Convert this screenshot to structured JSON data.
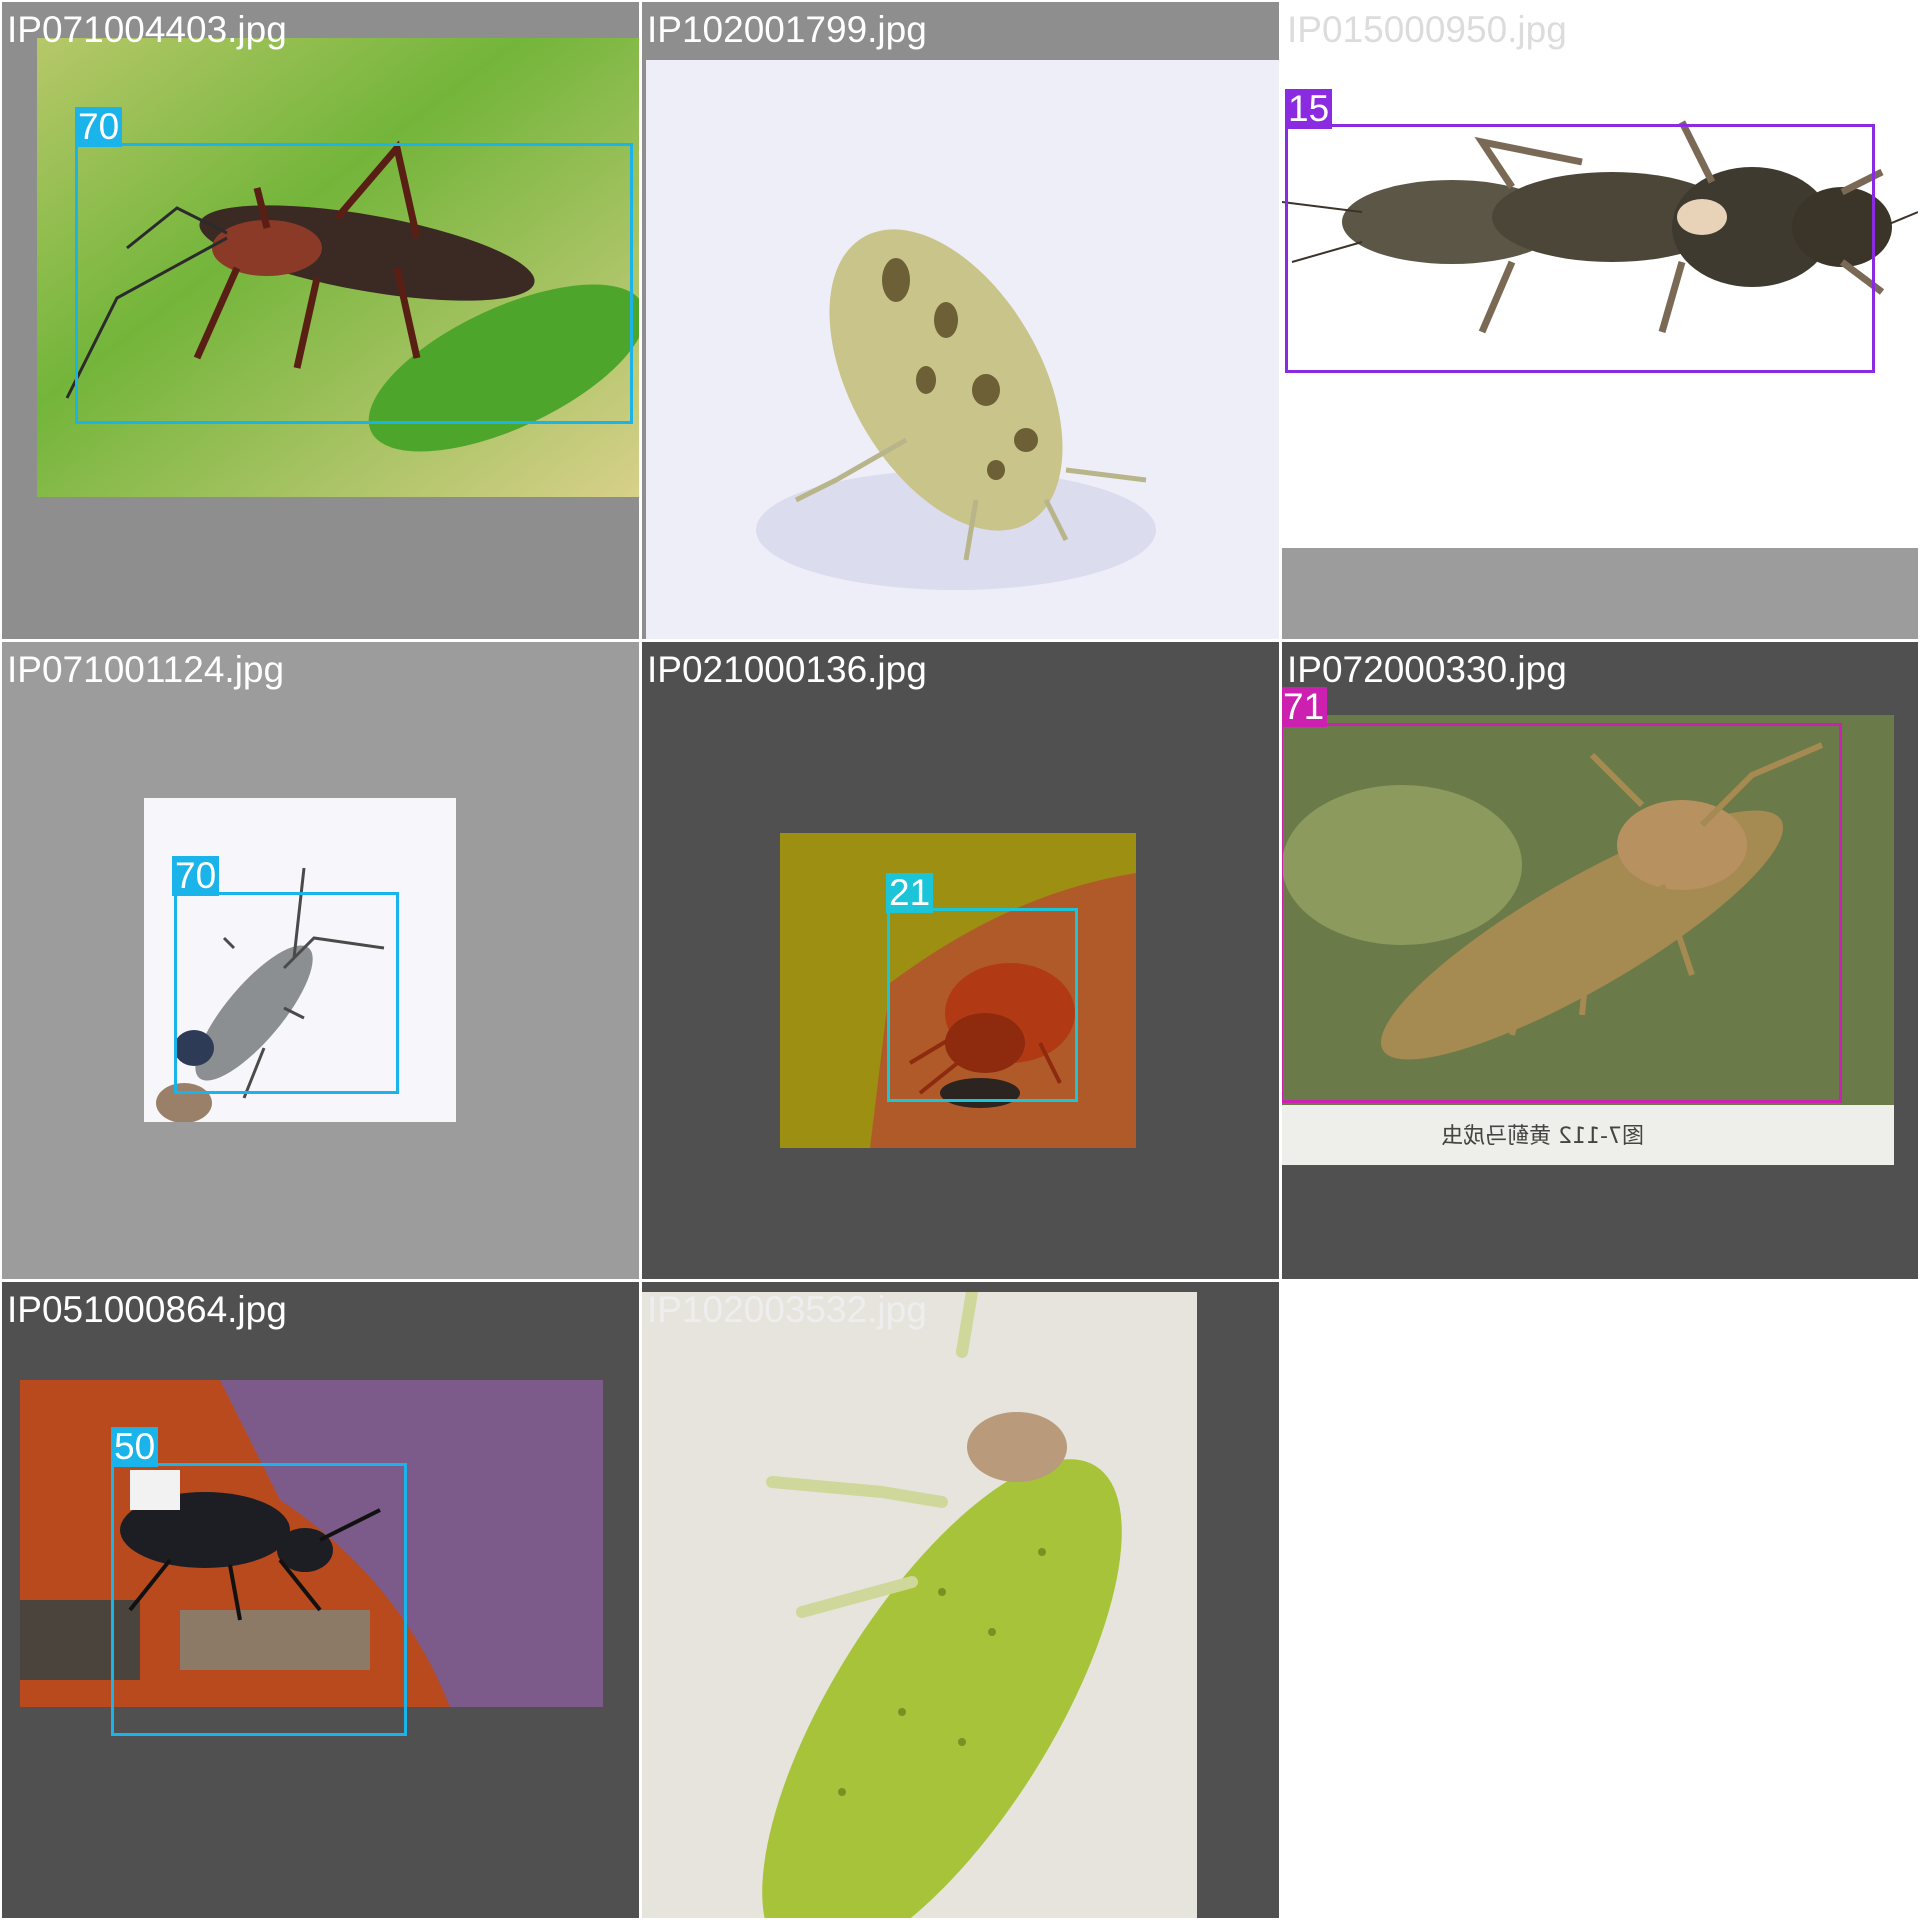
{
  "tiles": [
    {
      "filename": "IP071004403.jpg",
      "caption_color": "#ffffff",
      "label": "70",
      "box_color": "#1ab3ea"
    },
    {
      "filename": "IP102001799.jpg",
      "caption_color": "#ffffff"
    },
    {
      "filename": "IP015000950.jpg",
      "caption_color": "#dcdcdc",
      "label": "15",
      "box_color": "#8a2be2"
    },
    {
      "filename": "IP071001124.jpg",
      "caption_color": "#ffffff",
      "label": "70",
      "box_color": "#1ab3ea"
    },
    {
      "filename": "IP021000136.jpg",
      "caption_color": "#ffffff",
      "label": "21",
      "box_color": "#1cc4d8"
    },
    {
      "filename": "IP072000330.jpg",
      "caption_color": "#ffffff",
      "label": "71",
      "box_color": "#cc20b0"
    },
    {
      "filename": "IP051000864.jpg",
      "caption_color": "#ffffff",
      "label": "50",
      "box_color": "#1ab3ea"
    },
    {
      "filename": "IP102003532.jpg",
      "caption_color": "#eeeeee"
    }
  ],
  "colors": {
    "tile_background_light": "#8e8e8e",
    "tile_background_mid": "#9c9c9c",
    "tile_background_dark": "#505050",
    "grid_line": "#ffffff"
  }
}
